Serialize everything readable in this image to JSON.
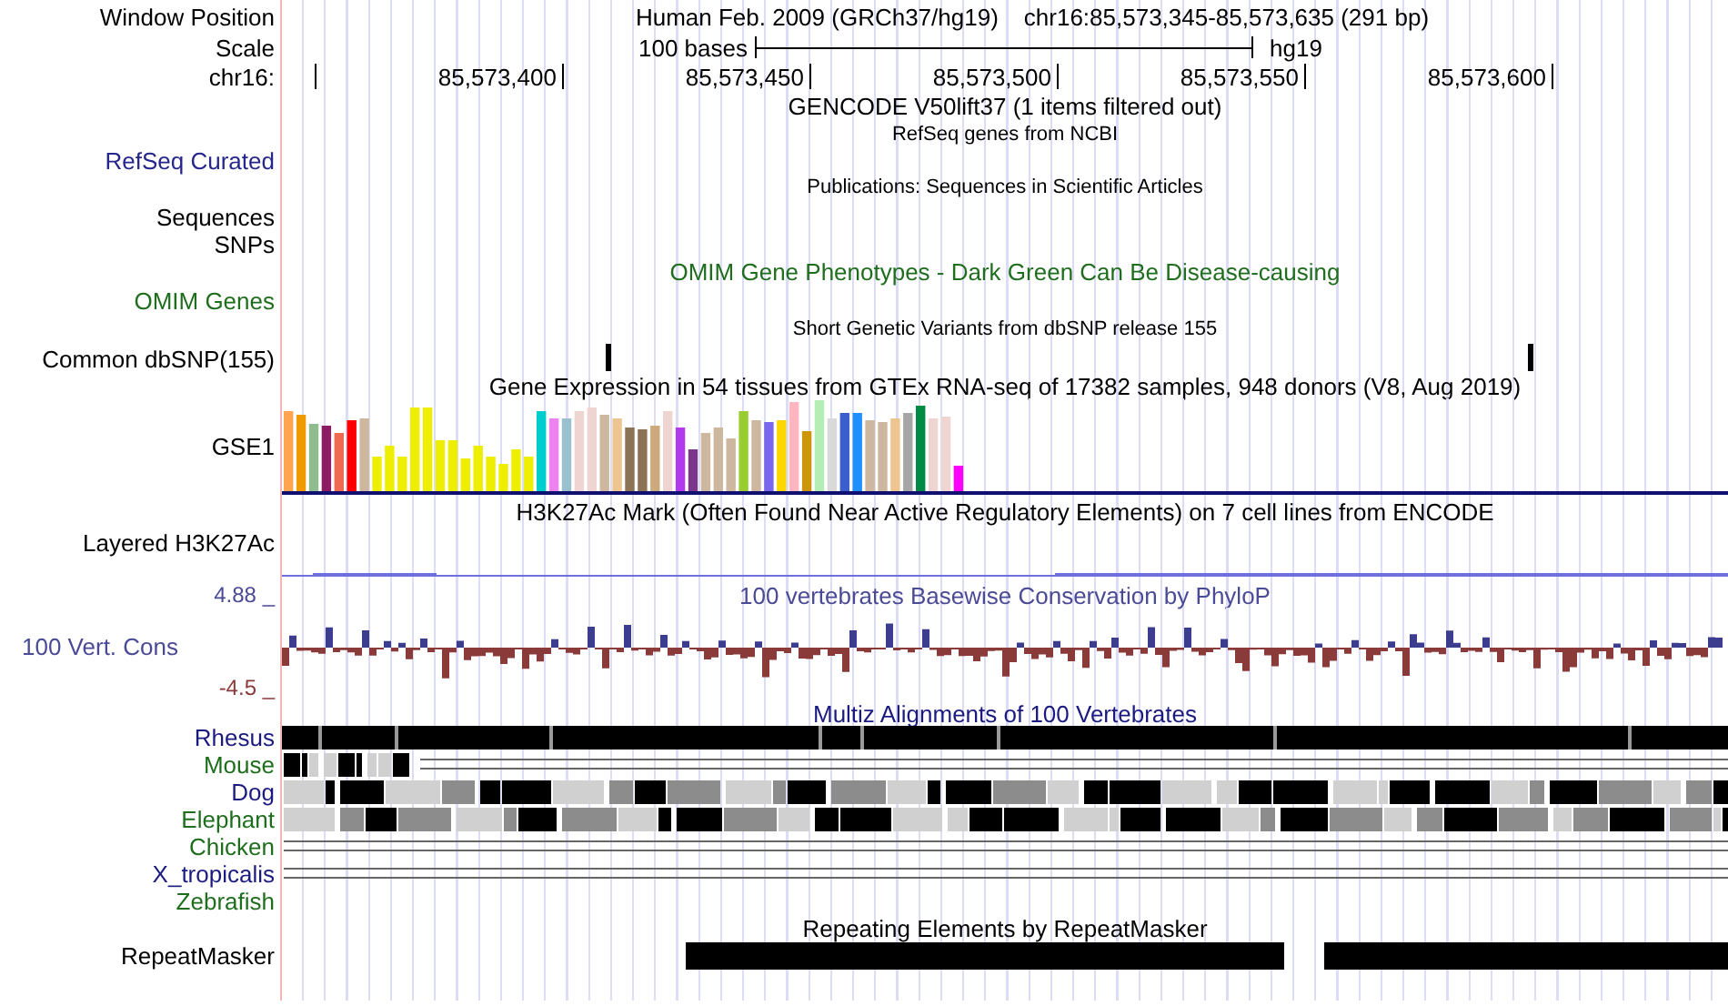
{
  "header": {
    "label": "Window Position",
    "assembly": "Human Feb. 2009 (GRCh37/hg19)",
    "position": "chr16:85,573,345-85,573,635 (291 bp)"
  },
  "scale": {
    "label": "Scale",
    "bar_label": "100 bases",
    "assembly": "hg19"
  },
  "ruler": {
    "label": "chr16:",
    "ticks": [
      "85,573,400",
      "85,573,450",
      "85,573,500",
      "85,573,550",
      "85,573,600"
    ]
  },
  "tracks": [
    {
      "kind": "title",
      "title": "GENCODE V50lift37 (1 items filtered out)"
    },
    {
      "kind": "note",
      "label": "RefSeq Curated",
      "title": "RefSeq genes from NCBI",
      "color": "#26268c"
    },
    {
      "kind": "note",
      "title": "Publications: Sequences in Scientific Articles"
    },
    {
      "kind": "label",
      "label": "Sequences"
    },
    {
      "kind": "label",
      "label": "SNPs"
    },
    {
      "kind": "genes",
      "label": "OMIM Genes",
      "title": "OMIM Gene Phenotypes - Dark Green Can Be Disease-causing",
      "color": "#1e6e1e"
    },
    {
      "kind": "variants",
      "label": "Common dbSNP(155)",
      "title": "Short Genetic Variants from dbSNP release 155"
    },
    {
      "kind": "expression",
      "label": "GSE1",
      "title": "Gene Expression in 54 tissues from GTEx RNA-seq of 17382 samples, 948 donors (V8, Aug 2019)"
    },
    {
      "kind": "signal",
      "label": "Layered H3K27Ac",
      "title": "H3K27Ac Mark (Often Found Near Active Regulatory Elements) on 7 cell lines from ENCODE"
    },
    {
      "kind": "conservation",
      "label": "100 Vert. Cons",
      "title": "100 vertebrates Basewise Conservation by PhyloP",
      "max_label": "4.88 _",
      "min_label": "-4.5 _",
      "color": "#4a4a96"
    },
    {
      "kind": "alignment",
      "title": "Multiz Alignments of 100 Vertebrates",
      "color": "#1a1a80",
      "species": [
        {
          "name": "Rhesus",
          "color": "#1a1a80",
          "kind": "full"
        },
        {
          "name": "Mouse",
          "color": "#1e6e1e",
          "kind": "partial"
        },
        {
          "name": "Dog",
          "color": "#1a1a80",
          "kind": "dense"
        },
        {
          "name": "Elephant",
          "color": "#1e6e1e",
          "kind": "dense"
        },
        {
          "name": "Chicken",
          "color": "#1e6e1e",
          "kind": "lines"
        },
        {
          "name": "X_tropicalis",
          "color": "#1a1a80",
          "kind": "lines"
        },
        {
          "name": "Zebrafish",
          "color": "#1e6e1e",
          "kind": "none"
        }
      ]
    },
    {
      "kind": "repeats",
      "label": "RepeatMasker",
      "title": "Repeating Elements by RepeatMasker"
    }
  ]
}
